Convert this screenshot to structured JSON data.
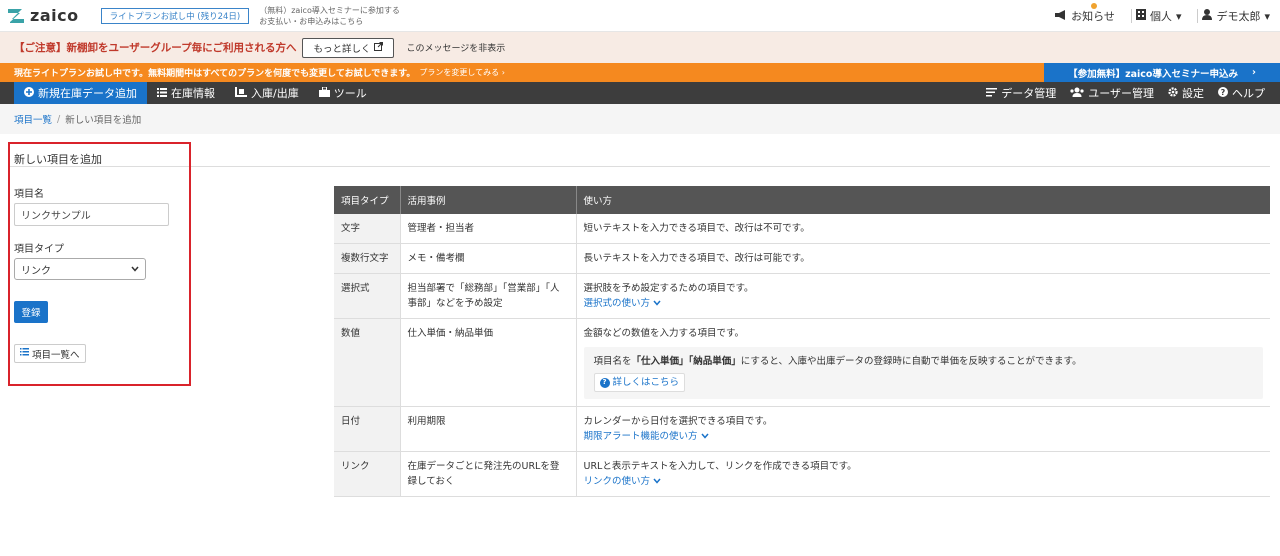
{
  "header": {
    "logo": "zaico",
    "trial_badge": "ライトプランお試し中 (残り24日)",
    "seminar_line1": "（無料）zaico導入セミナーに参加する",
    "seminar_line2": "お支払い・お申込みはこちら",
    "notifications": "お知らせ",
    "personal": "個人",
    "user": "デモ太郎"
  },
  "notice": {
    "text": "【ご注意】新棚卸をユーザーグループ毎にご利用される方へ",
    "more_button": "もっと詳しく",
    "hide": "このメッセージを非表示"
  },
  "trial_bar": {
    "text": "現在ライトプランお試し中です。無料期間中はすべてのプランを何度でも変更してお試しできます。",
    "change_link": "プランを変更してみる",
    "seminar": "【参加無料】zaico導入セミナー申込み"
  },
  "nav": {
    "new_item": "新規在庫データ追加",
    "inventory": "在庫情報",
    "in_out": "入庫/出庫",
    "tools": "ツール",
    "data_manage": "データ管理",
    "user_manage": "ユーザー管理",
    "settings": "設定",
    "help": "ヘルプ"
  },
  "breadcrumb": {
    "parent": "項目一覧",
    "current": "新しい項目を追加"
  },
  "form": {
    "title": "新しい項目を追加",
    "name_label": "項目名",
    "name_value": "リンクサンプル",
    "type_label": "項目タイプ",
    "type_value": "リンク",
    "register": "登録",
    "back": "項目一覧へ"
  },
  "table": {
    "headers": [
      "項目タイプ",
      "活用事例",
      "使い方"
    ],
    "rows": [
      {
        "type": "文字",
        "example": "管理者・担当者",
        "usage": "短いテキストを入力できる項目で、改行は不可です。"
      },
      {
        "type": "複数行文字",
        "example": "メモ・備考欄",
        "usage": "長いテキストを入力できる項目で、改行は可能です。"
      },
      {
        "type": "選択式",
        "example": "担当部署で「総務部」「営業部」「人事部」などを予め設定",
        "usage": "選択肢を予め設定するための項目です。",
        "link": "選択式の使い方"
      },
      {
        "type": "数値",
        "example": "仕入単価・納品単価",
        "usage": "金額などの数値を入力する項目です。",
        "tip_pre": "項目名を",
        "tip_b1": "「仕入単価」",
        "tip_b2": "「納品単価」",
        "tip_post": "にすると、入庫や出庫データの登録時に自動で単価を反映することができます。",
        "detail": "詳しくはこちら"
      },
      {
        "type": "日付",
        "example": "利用期限",
        "usage": "カレンダーから日付を選択できる項目です。",
        "link": "期限アラート機能の使い方"
      },
      {
        "type": "リンク",
        "example": "在庫データごとに発注先のURLを登録しておく",
        "usage": "URLと表示テキストを入力して、リンクを作成できる項目です。",
        "link": "リンクの使い方"
      }
    ]
  },
  "colors": {
    "accent": "#1a73c9",
    "orange": "#f5891f",
    "highlight": "#d9232b"
  }
}
